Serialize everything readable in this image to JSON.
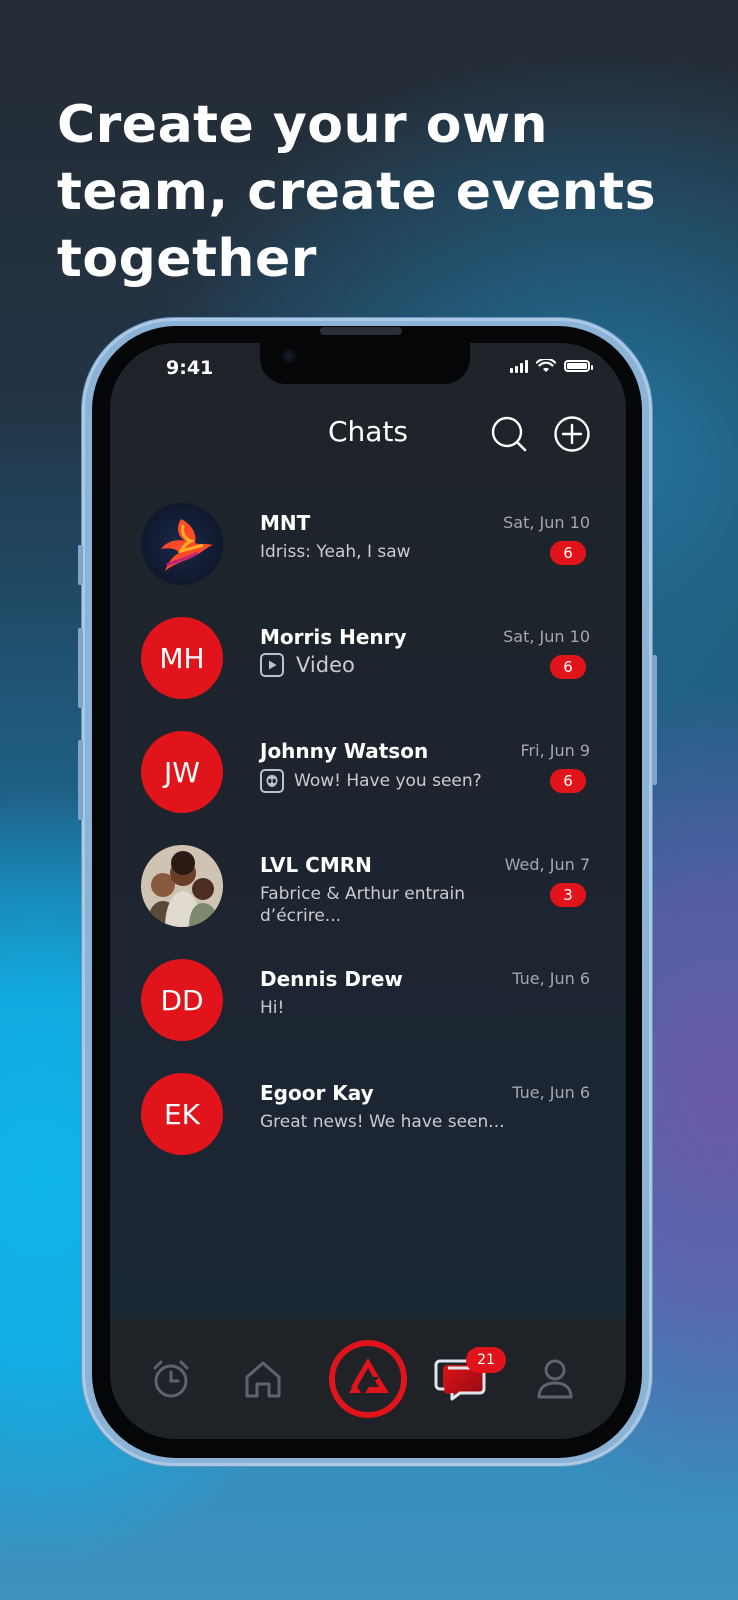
{
  "headline": "Create your own team, create events together",
  "status_bar": {
    "time": "9:41"
  },
  "header": {
    "title": "Chats"
  },
  "chats": [
    {
      "name": "MNT",
      "date": "Sat, Jun 10",
      "preview": "Idriss: Yeah, I saw",
      "unread": "6",
      "avatar": "phoenix-logo"
    },
    {
      "name": "Morris Henry",
      "date": "Sat, Jun 10",
      "preview": "Video",
      "unread": "6",
      "initials": "MH"
    },
    {
      "name": "Johnny Watson",
      "date": "Fri, Jun 9",
      "preview": "Wow! Have you seen?",
      "unread": "6",
      "initials": "JW"
    },
    {
      "name": "LVL CMRN",
      "date": "Wed, Jun 7",
      "preview": "Fabrice & Arthur entrain d’écrire...",
      "unread": "3",
      "avatar": "group-photo"
    },
    {
      "name": "Dennis Drew",
      "date": "Tue, Jun 6",
      "preview": "Hi!",
      "initials": "DD"
    },
    {
      "name": "Egoor Kay",
      "date": "Tue, Jun 6",
      "preview": "Great news! We have seen...",
      "initials": "EK"
    }
  ],
  "tabbar": {
    "items": [
      "alarm-clock-icon",
      "home-icon",
      "brand-logo-icon",
      "chats-icon",
      "profile-icon"
    ],
    "chats_badge": "21"
  },
  "colors": {
    "accent": "#e0141a",
    "screen_bg": "#1c2530",
    "tabbar_bg": "#1f2226"
  }
}
